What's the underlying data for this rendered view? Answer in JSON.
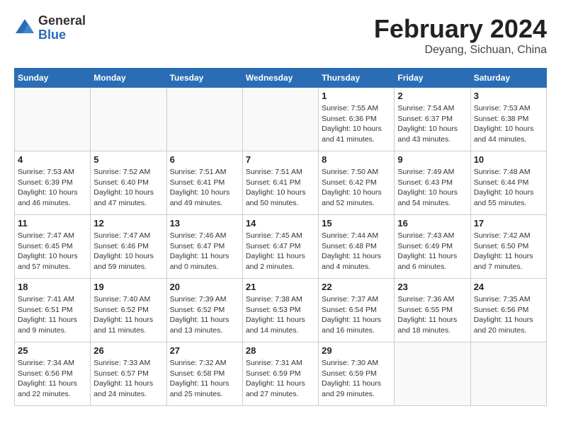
{
  "header": {
    "logo_general": "General",
    "logo_blue": "Blue",
    "title": "February 2024",
    "location": "Deyang, Sichuan, China"
  },
  "weekdays": [
    "Sunday",
    "Monday",
    "Tuesday",
    "Wednesday",
    "Thursday",
    "Friday",
    "Saturday"
  ],
  "weeks": [
    [
      {
        "day": "",
        "info": ""
      },
      {
        "day": "",
        "info": ""
      },
      {
        "day": "",
        "info": ""
      },
      {
        "day": "",
        "info": ""
      },
      {
        "day": "1",
        "info": "Sunrise: 7:55 AM\nSunset: 6:36 PM\nDaylight: 10 hours\nand 41 minutes."
      },
      {
        "day": "2",
        "info": "Sunrise: 7:54 AM\nSunset: 6:37 PM\nDaylight: 10 hours\nand 43 minutes."
      },
      {
        "day": "3",
        "info": "Sunrise: 7:53 AM\nSunset: 6:38 PM\nDaylight: 10 hours\nand 44 minutes."
      }
    ],
    [
      {
        "day": "4",
        "info": "Sunrise: 7:53 AM\nSunset: 6:39 PM\nDaylight: 10 hours\nand 46 minutes."
      },
      {
        "day": "5",
        "info": "Sunrise: 7:52 AM\nSunset: 6:40 PM\nDaylight: 10 hours\nand 47 minutes."
      },
      {
        "day": "6",
        "info": "Sunrise: 7:51 AM\nSunset: 6:41 PM\nDaylight: 10 hours\nand 49 minutes."
      },
      {
        "day": "7",
        "info": "Sunrise: 7:51 AM\nSunset: 6:41 PM\nDaylight: 10 hours\nand 50 minutes."
      },
      {
        "day": "8",
        "info": "Sunrise: 7:50 AM\nSunset: 6:42 PM\nDaylight: 10 hours\nand 52 minutes."
      },
      {
        "day": "9",
        "info": "Sunrise: 7:49 AM\nSunset: 6:43 PM\nDaylight: 10 hours\nand 54 minutes."
      },
      {
        "day": "10",
        "info": "Sunrise: 7:48 AM\nSunset: 6:44 PM\nDaylight: 10 hours\nand 55 minutes."
      }
    ],
    [
      {
        "day": "11",
        "info": "Sunrise: 7:47 AM\nSunset: 6:45 PM\nDaylight: 10 hours\nand 57 minutes."
      },
      {
        "day": "12",
        "info": "Sunrise: 7:47 AM\nSunset: 6:46 PM\nDaylight: 10 hours\nand 59 minutes."
      },
      {
        "day": "13",
        "info": "Sunrise: 7:46 AM\nSunset: 6:47 PM\nDaylight: 11 hours\nand 0 minutes."
      },
      {
        "day": "14",
        "info": "Sunrise: 7:45 AM\nSunset: 6:47 PM\nDaylight: 11 hours\nand 2 minutes."
      },
      {
        "day": "15",
        "info": "Sunrise: 7:44 AM\nSunset: 6:48 PM\nDaylight: 11 hours\nand 4 minutes."
      },
      {
        "day": "16",
        "info": "Sunrise: 7:43 AM\nSunset: 6:49 PM\nDaylight: 11 hours\nand 6 minutes."
      },
      {
        "day": "17",
        "info": "Sunrise: 7:42 AM\nSunset: 6:50 PM\nDaylight: 11 hours\nand 7 minutes."
      }
    ],
    [
      {
        "day": "18",
        "info": "Sunrise: 7:41 AM\nSunset: 6:51 PM\nDaylight: 11 hours\nand 9 minutes."
      },
      {
        "day": "19",
        "info": "Sunrise: 7:40 AM\nSunset: 6:52 PM\nDaylight: 11 hours\nand 11 minutes."
      },
      {
        "day": "20",
        "info": "Sunrise: 7:39 AM\nSunset: 6:52 PM\nDaylight: 11 hours\nand 13 minutes."
      },
      {
        "day": "21",
        "info": "Sunrise: 7:38 AM\nSunset: 6:53 PM\nDaylight: 11 hours\nand 14 minutes."
      },
      {
        "day": "22",
        "info": "Sunrise: 7:37 AM\nSunset: 6:54 PM\nDaylight: 11 hours\nand 16 minutes."
      },
      {
        "day": "23",
        "info": "Sunrise: 7:36 AM\nSunset: 6:55 PM\nDaylight: 11 hours\nand 18 minutes."
      },
      {
        "day": "24",
        "info": "Sunrise: 7:35 AM\nSunset: 6:56 PM\nDaylight: 11 hours\nand 20 minutes."
      }
    ],
    [
      {
        "day": "25",
        "info": "Sunrise: 7:34 AM\nSunset: 6:56 PM\nDaylight: 11 hours\nand 22 minutes."
      },
      {
        "day": "26",
        "info": "Sunrise: 7:33 AM\nSunset: 6:57 PM\nDaylight: 11 hours\nand 24 minutes."
      },
      {
        "day": "27",
        "info": "Sunrise: 7:32 AM\nSunset: 6:58 PM\nDaylight: 11 hours\nand 25 minutes."
      },
      {
        "day": "28",
        "info": "Sunrise: 7:31 AM\nSunset: 6:59 PM\nDaylight: 11 hours\nand 27 minutes."
      },
      {
        "day": "29",
        "info": "Sunrise: 7:30 AM\nSunset: 6:59 PM\nDaylight: 11 hours\nand 29 minutes."
      },
      {
        "day": "",
        "info": ""
      },
      {
        "day": "",
        "info": ""
      }
    ]
  ]
}
